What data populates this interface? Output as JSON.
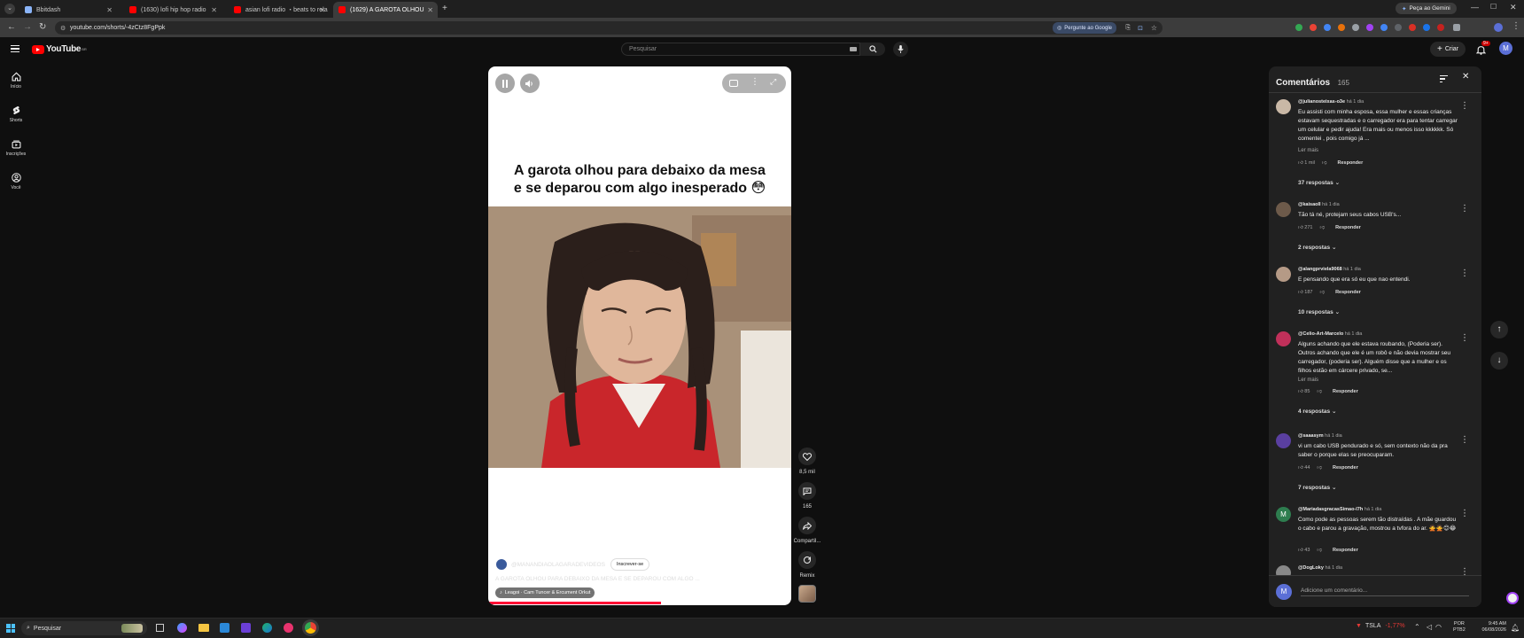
{
  "browser": {
    "tabs": [
      {
        "label": "Bbitdash",
        "fav_color": "#8ab4f8"
      },
      {
        "label": "(1630) lofi hip hop radio",
        "fav_color": "#ff0000"
      },
      {
        "label": "asian lofi radio  ・beats to rela",
        "fav_color": "#ff0000"
      },
      {
        "label": "(1629) A GAROTA OLHOU",
        "fav_color": "#ff0000"
      }
    ],
    "url": "youtube.com/shorts/-4zCtz8FgPpk",
    "ask_google": "Pergunte ao Google",
    "gemini": "Peça ao Gemini"
  },
  "youtube": {
    "logo": "YouTube",
    "logo_region": "BR",
    "search_placeholder": "Pesquisar",
    "create_label": "Criar",
    "notif_badge": "9+",
    "avatar_letter": "M",
    "sidebar": [
      {
        "label": "Início",
        "icon": "home-icon"
      },
      {
        "label": "Shorts",
        "icon": "shorts-icon"
      },
      {
        "label": "Inscrições",
        "icon": "subscriptions-icon"
      },
      {
        "label": "Você",
        "icon": "you-icon"
      }
    ]
  },
  "short": {
    "title_line1": "A garota olhou para debaixo da mesa",
    "title_line2": "e se deparou com algo inesperado 😳",
    "channel": "@MANANDIAOLAGARADEVIDEOS",
    "subscribe": "Inscrever-se",
    "caption": "A GAROTA OLHOU PARA DEBAIXO DA MESA E SE DEPAROU COM ALGO ...",
    "music": "Leagoi · Cam Tuncer & Ercument Orkut",
    "progress": 0.57
  },
  "actions": {
    "likes": "8,5 mil",
    "comments": "165",
    "share": "Compartil...",
    "remix": "Remix"
  },
  "comments_panel": {
    "title": "Comentários",
    "count": "165",
    "add_placeholder": "Adicione um comentário...",
    "items": [
      {
        "user": "@julianosteixas-o3e",
        "time": "há 1 dia",
        "text": "Eu assisti com minha esposa, essa mulher e essas crianças estavam sequestradas e o carregador era para tentar carregar um celular e pedir ajuda! Era mais ou menos isso kkkkkk. Só comentei , pois comigo já ...",
        "more": "Ler mais",
        "likes": "1 mil",
        "reply": "Responder",
        "replies": "37 respostas",
        "avatar_color": "#c9b8a6"
      },
      {
        "user": "@kaisaoll",
        "time": "há 1 dia",
        "text": "Tão tá né, protejam seus cabos USB's...",
        "more": "",
        "likes": "271",
        "reply": "Responder",
        "replies": "2 respostas",
        "avatar_color": "#6d5a4a"
      },
      {
        "user": "@alangprviela9068",
        "time": "há 1 dia",
        "text": "E pensando que era só eu que nao entendi.",
        "more": "",
        "likes": "187",
        "reply": "Responder",
        "replies": "10 respostas",
        "avatar_color": "#b59a86"
      },
      {
        "user": "@Celio-Art-Marcelo",
        "time": "há 1 dia",
        "text": "Alguns achando que ele estava roubando, (Poderia ser). Outros achando que ele é um robô e não devia mostrar seu carregador, (poderia ser). Alguém disse que a mulher e os filhos estão em cárcere privado, se...",
        "more": "Ler mais",
        "likes": "85",
        "reply": "Responder",
        "replies": "4 respostas",
        "avatar_color": "#c0305a"
      },
      {
        "user": "@saaasym",
        "time": "há 1 dia",
        "text": "vi um cabo USB pendurado e só, sem contexto não da pra saber o porque elas se preocuparam.",
        "more": "",
        "likes": "44",
        "reply": "Responder",
        "replies": "7 respostas",
        "avatar_color": "#5a3fa0"
      },
      {
        "user": "@MariadasgracasSimao-l7h",
        "time": "há 1 dia",
        "text": "Como pode as pessoas serem tão distraídas . A mãe guardou o cabo e parou a gravação, mostrou a tvfora do ar. 🙅🙅😊😂",
        "more": "",
        "likes": "43",
        "reply": "Responder",
        "replies": "",
        "avatar_color": "#2e7d4f",
        "avatar_letter": "M"
      },
      {
        "user": "@DogLoky",
        "time": "há 1 dia",
        "text": "",
        "more": "",
        "likes": "",
        "reply": "",
        "replies": "",
        "avatar_color": "#888888"
      }
    ]
  },
  "taskbar": {
    "search": "Pesquisar",
    "stock_name": "TSLA",
    "stock_change": "-1,77%",
    "lang": "POR",
    "lang_sub": "PTB2",
    "time": "9:45 AM",
    "date": "06/08/2026"
  }
}
